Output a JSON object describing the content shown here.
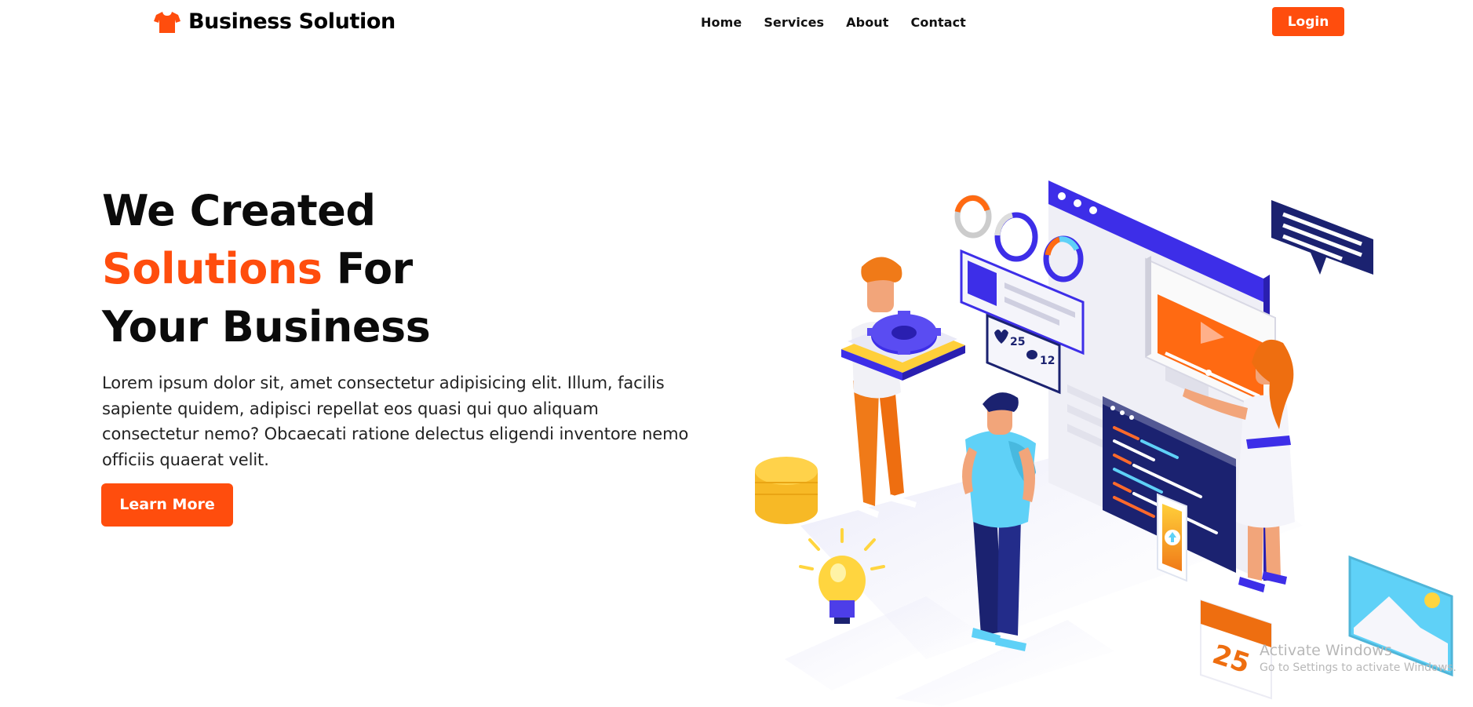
{
  "header": {
    "brand": {
      "name": "Business Solution",
      "icon": "tshirt-icon"
    },
    "nav": [
      "Home",
      "Services",
      "About",
      "Contact"
    ],
    "login_label": "Login"
  },
  "hero": {
    "title_line1": "We Created",
    "title_line2_accent": "Solutions",
    "title_line2_rest": " For",
    "title_line3": "Your Business",
    "description": "Lorem ipsum dolor sit, amet consectetur adipisicing elit. Illum, facilis sapiente quidem, adipisci repellat eos quasi qui quo aliquam consectetur nemo? Obcaecati ratione delectus eligendi inventore nemo officiis quaerat velit.",
    "cta_label": "Learn More"
  },
  "illustration": {
    "likes_count": "25",
    "comments_count": "12",
    "calendar_day": "25"
  },
  "watermark": {
    "line1": "Activate Windows",
    "line2": "Go to Settings to activate Windows."
  },
  "colors": {
    "accent": "#ff4d0d",
    "text": "#0b0b0b",
    "illustration_blue": "#3d2ee8",
    "illustration_navy": "#1b2270",
    "illustration_cyan": "#5fd1f7",
    "illustration_yellow": "#ffcf3a"
  }
}
